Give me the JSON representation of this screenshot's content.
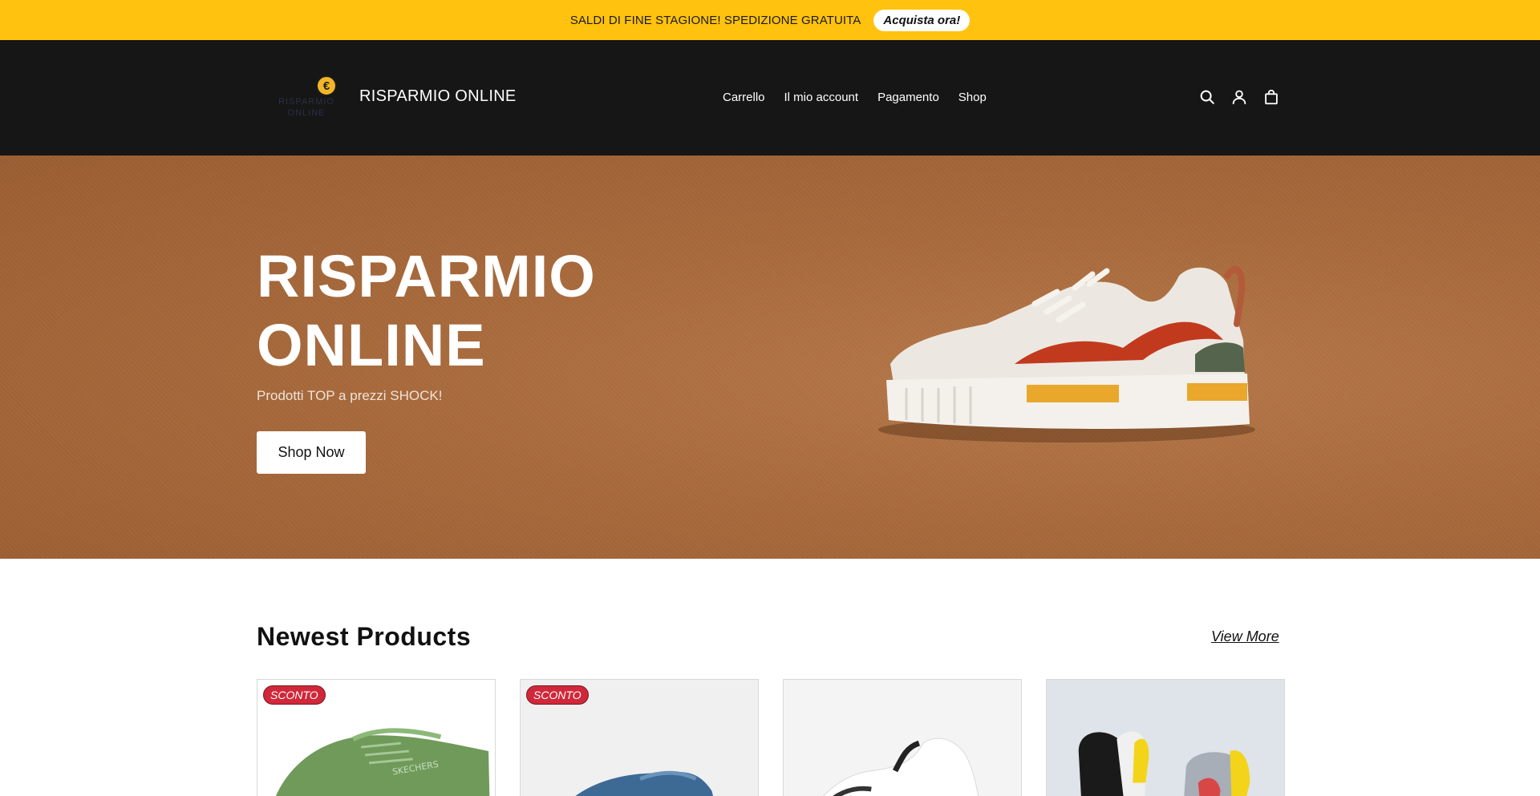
{
  "announcement": {
    "text": "SALDI DI FINE STAGIONE! SPEDIZIONE GRATUITA",
    "button_label": "Acquista ora!"
  },
  "header": {
    "logo_symbol": "€",
    "logo_text": "RISPARMIO ONLINE",
    "site_name": "RISPARMIO ONLINE",
    "nav": [
      {
        "label": "Carrello"
      },
      {
        "label": "Il mio account"
      },
      {
        "label": "Pagamento"
      },
      {
        "label": "Shop"
      }
    ],
    "icons": [
      "search-icon",
      "account-icon",
      "bag-icon"
    ]
  },
  "hero": {
    "title_line1": "RISPARMIO",
    "title_line2": "ONLINE",
    "subtitle": "Prodotti TOP a prezzi SHOCK!",
    "button_label": "Shop Now",
    "background_color": "#a86a3c"
  },
  "newest": {
    "title": "Newest Products",
    "view_more": "View More",
    "products": [
      {
        "badge": "SCONTO",
        "image": "green-sneaker"
      },
      {
        "badge": "SCONTO",
        "image": "blue-sneaker"
      },
      {
        "badge": "",
        "image": "white-sneaker"
      },
      {
        "badge": "",
        "image": "sport-shoe-pair"
      }
    ]
  },
  "colors": {
    "announcement_bg": "#ffc20e",
    "header_bg": "#161616",
    "badge_bg": "#d0283a"
  }
}
